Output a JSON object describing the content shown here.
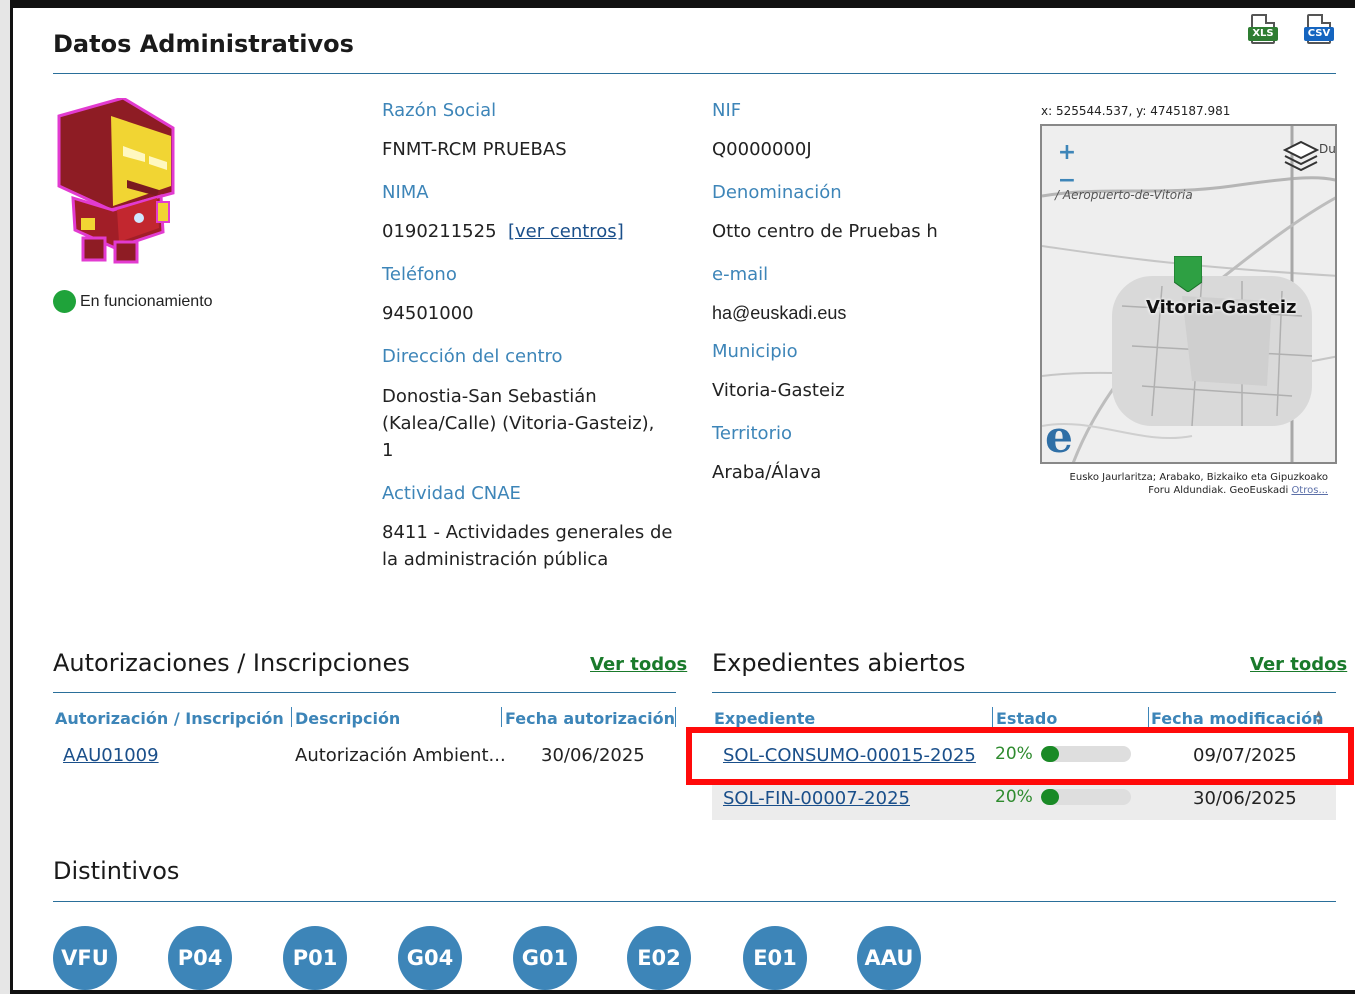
{
  "page": {
    "title": "Datos Administrativos"
  },
  "exports": {
    "xls_label": "XLS",
    "csv_label": "CSV"
  },
  "center": {
    "status": "En funcionamiento",
    "status_color": "#1fa33a",
    "razon_social_label": "Razón Social",
    "razon_social": "FNMT-RCM PRUEBAS",
    "nima_label": "NIMA",
    "nima": "0190211525",
    "nima_link": "[ver centros]",
    "telefono_label": "Teléfono",
    "telefono": "94501000",
    "direccion_label": "Dirección del centro",
    "direccion_line1": "Donostia-San Sebastián",
    "direccion_line2": "(Kalea/Calle) (Vitoria-Gasteiz),",
    "direccion_line3": "1",
    "cnae_label": "Actividad CNAE",
    "cnae_line1": "8411 - Actividades generales de",
    "cnae_line2": "la administración pública",
    "nif_label": "NIF",
    "nif": "Q0000000J",
    "denominacion_label": "Denominación",
    "denominacion": "Otto centro de Pruebas h",
    "email_label": "e-mail",
    "email": "ha@euskadi.eus",
    "municipio_label": "Municipio",
    "municipio": "Vitoria-Gasteiz",
    "territorio_label": "Territorio",
    "territorio": "Araba/Álava"
  },
  "map": {
    "coords": "x: 525544.537, y: 4745187.981",
    "zoom_in": "+",
    "zoom_out": "−",
    "city": "Vitoria-Gasteiz",
    "airport": "/ Aeropuerto-de-Vitoria",
    "du": "Du",
    "logo": "e",
    "attribution": "Eusko Jaurlaritza; Arabako, Bizkaiko eta Gipuzkoako Foru Aldundiak. GeoEuskadi",
    "attribution_link": "Otros..."
  },
  "autorizaciones": {
    "title": "Autorizaciones / Inscripciones",
    "ver_todos": "Ver todos",
    "columns": [
      "Autorización / Inscripción",
      "Descripción",
      "Fecha autorización"
    ],
    "rows": [
      {
        "id": "AAU01009",
        "descripcion": "Autorización Ambient...",
        "fecha": "30/06/2025"
      }
    ]
  },
  "expedientes": {
    "title": "Expedientes abiertos",
    "ver_todos": "Ver todos",
    "columns": [
      "Expediente",
      "Estado",
      "Fecha modificación"
    ],
    "rows": [
      {
        "id": "SOL-CONSUMO-00015-2025",
        "estado": "20%",
        "progress": 0.2,
        "fecha": "09/07/2025"
      },
      {
        "id": "SOL-FIN-00007-2025",
        "estado": "20%",
        "progress": 0.2,
        "fecha": "30/06/2025"
      }
    ]
  },
  "distintivos": {
    "title": "Distintivos",
    "badges": [
      "VFU",
      "P04",
      "P01",
      "G04",
      "G01",
      "E02",
      "E01",
      "AAU"
    ]
  },
  "colors": {
    "accent": "#3d85b8",
    "link_green": "#1a7a2b",
    "progress": "#1a8a26",
    "highlight": "#ff0a0a"
  }
}
